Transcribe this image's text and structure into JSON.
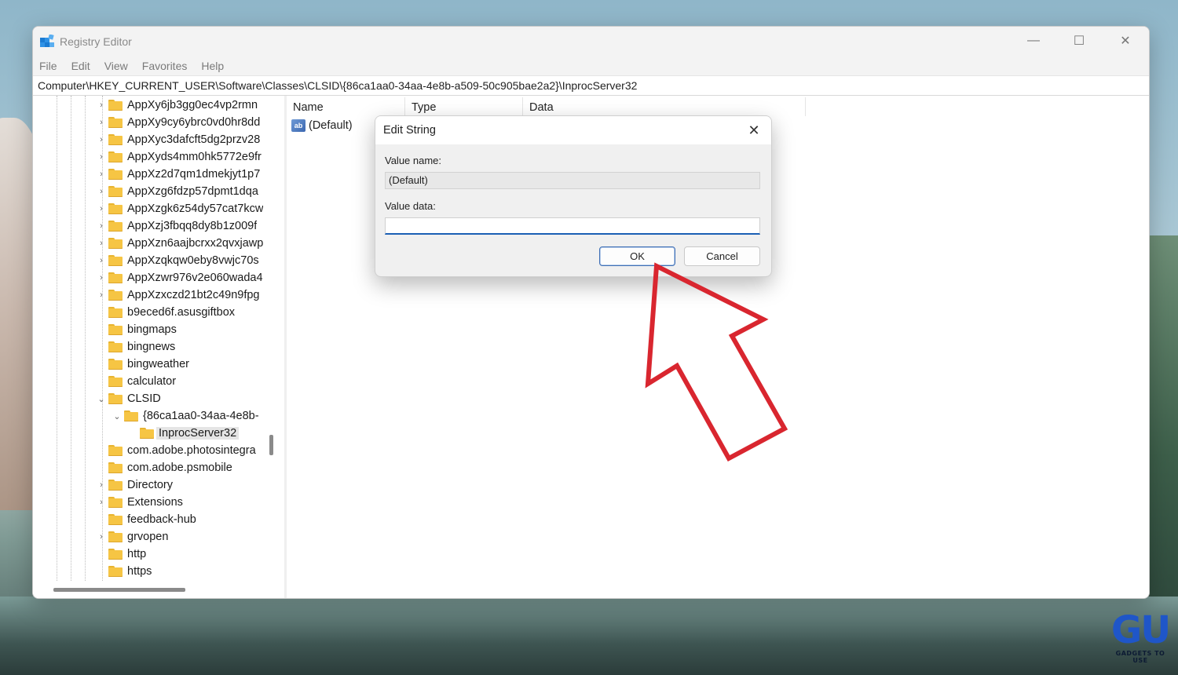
{
  "window": {
    "title": "Registry Editor",
    "minimize_glyph": "—",
    "maximize_glyph": "☐",
    "close_glyph": "✕"
  },
  "menu": [
    "File",
    "Edit",
    "View",
    "Favorites",
    "Help"
  ],
  "address": "Computer\\HKEY_CURRENT_USER\\Software\\Classes\\CLSID\\{86ca1aa0-34aa-4e8b-a509-50c905bae2a2}\\InprocServer32",
  "tree": [
    {
      "label": "AppXy6jb3gg0ec4vp2rmn",
      "expander": "›"
    },
    {
      "label": "AppXy9cy6ybrc0vd0hr8dd",
      "expander": "›"
    },
    {
      "label": "AppXyc3dafcft5dg2przv28",
      "expander": "›"
    },
    {
      "label": "AppXyds4mm0hk5772e9fr",
      "expander": "›"
    },
    {
      "label": "AppXz2d7qm1dmekjyt1p7",
      "expander": "›"
    },
    {
      "label": "AppXzg6fdzp57dpmt1dqa",
      "expander": "›"
    },
    {
      "label": "AppXzgk6z54dy57cat7kcw",
      "expander": "›"
    },
    {
      "label": "AppXzj3fbqq8dy8b1z009f",
      "expander": "›"
    },
    {
      "label": "AppXzn6aajbcrxx2qvxjawp",
      "expander": "›"
    },
    {
      "label": "AppXzqkqw0eby8vwjc70s",
      "expander": "›"
    },
    {
      "label": "AppXzwr976v2e060wada4",
      "expander": "›"
    },
    {
      "label": "AppXzxczd21bt2c49n9fpg",
      "expander": "›"
    },
    {
      "label": "b9eced6f.asusgiftbox",
      "expander": ""
    },
    {
      "label": "bingmaps",
      "expander": ""
    },
    {
      "label": "bingnews",
      "expander": ""
    },
    {
      "label": "bingweather",
      "expander": ""
    },
    {
      "label": "calculator",
      "expander": ""
    },
    {
      "label": "CLSID",
      "expander": "⌄"
    },
    {
      "label": "{86ca1aa0-34aa-4e8b-",
      "expander": "⌄"
    },
    {
      "label": "InprocServer32",
      "expander": ""
    },
    {
      "label": "com.adobe.photosintegra",
      "expander": ""
    },
    {
      "label": "com.adobe.psmobile",
      "expander": ""
    },
    {
      "label": "Directory",
      "expander": "›"
    },
    {
      "label": "Extensions",
      "expander": "›"
    },
    {
      "label": "feedback-hub",
      "expander": ""
    },
    {
      "label": "grvopen",
      "expander": "›"
    },
    {
      "label": "http",
      "expander": ""
    },
    {
      "label": "https",
      "expander": ""
    }
  ],
  "list": {
    "columns": [
      "Name",
      "Type",
      "Data"
    ],
    "rows": [
      {
        "icon": "ab",
        "name": "(Default)"
      }
    ]
  },
  "dialog": {
    "title": "Edit String",
    "close_glyph": "✕",
    "value_name_label": "Value name:",
    "value_name": "(Default)",
    "value_data_label": "Value data:",
    "value_data": "",
    "ok_label": "OK",
    "cancel_label": "Cancel"
  },
  "annotation": {
    "arrow_color": "#d9262f"
  },
  "watermark": {
    "logo": "GU",
    "tagline": "GADGETS TO USE",
    "color": "#1f56c8"
  }
}
